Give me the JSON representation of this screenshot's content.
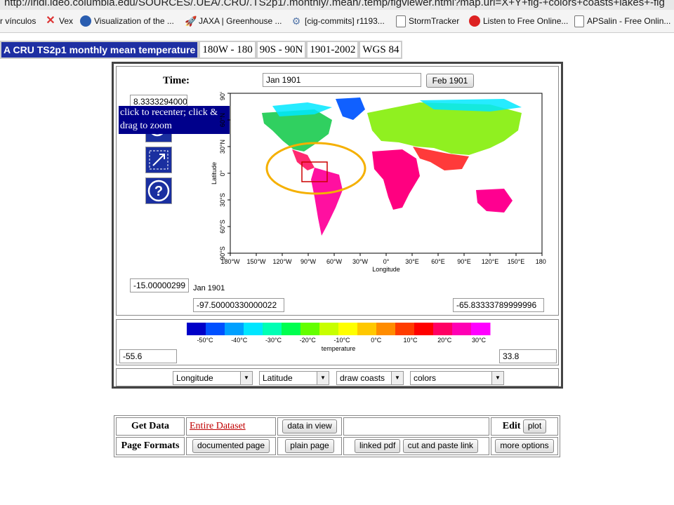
{
  "browser": {
    "url": "http://iridl.ldeo.columbia.edu/SOURCES/.UEA/.CRU/.TS2p1/.monthly/.mean/.temp/figviewer.html?map.url=X+Y+fig-+colors+coasts+lakes+-fig",
    "bookmarks": [
      {
        "label": "r vínculos",
        "icon": "none"
      },
      {
        "label": "Vex",
        "icon": "x-red-icon"
      },
      {
        "label": "Visualization of the ...",
        "icon": "globe-icon"
      },
      {
        "label": "JAXA | Greenhouse ...",
        "icon": "rocket-icon"
      },
      {
        "label": "[cig-commits] r1193...",
        "icon": "gear-icon"
      },
      {
        "label": "StormTracker",
        "icon": "page-icon"
      },
      {
        "label": "Listen to Free Online...",
        "icon": "radio-icon"
      },
      {
        "label": "APSalin - Free Onlin...",
        "icon": "page-icon"
      }
    ]
  },
  "breadcrumbs": [
    "A CRU TS2p1 monthly mean temperature",
    "180W - 180",
    "90S - 90N",
    "1901-2002",
    "WGS 84"
  ],
  "viewer": {
    "time_label": "Time:",
    "time_value": "Jan 1901",
    "next_time_button": "Feb 1901",
    "lat_top_value": "8.3333294000",
    "lat_bottom_value": "-15.00000299",
    "lon_left_value": "-97.50000330000022",
    "lon_right_value": "-65.83333789999996",
    "map_date_caption": "Jan 1901",
    "tooltip": "click to recenter; click & drag to zoom",
    "tools": [
      "zoom-in-icon",
      "expand-icon",
      "help-icon"
    ],
    "map": {
      "xlabel": "Longitude",
      "ylabel": "Latitude",
      "x_ticks": [
        "180°W",
        "150°W",
        "120°W",
        "90°W",
        "60°W",
        "30°W",
        "0°",
        "30°E",
        "60°E",
        "90°E",
        "120°E",
        "150°E",
        "180°"
      ],
      "y_ticks": [
        "90°S",
        "60°S",
        "30°S",
        "0°",
        "30°N",
        "60°N",
        "90°N"
      ]
    },
    "colorbar": {
      "ticks": [
        "-50°C",
        "-40°C",
        "-30°C",
        "-20°C",
        "-10°C",
        "0°C",
        "10°C",
        "20°C",
        "30°C"
      ],
      "label": "temperature",
      "min_value": "-55.6",
      "max_value": "33.8",
      "colors": [
        "#0000c8",
        "#0050ff",
        "#00a0ff",
        "#00e6ff",
        "#00ffb4",
        "#00ff50",
        "#64ff00",
        "#c8ff00",
        "#ffff00",
        "#ffc800",
        "#ff8c00",
        "#ff3c00",
        "#ff0000",
        "#ff0064",
        "#ff00b4",
        "#ff00ff"
      ]
    },
    "controls": [
      {
        "value": "Longitude"
      },
      {
        "value": "Latitude"
      },
      {
        "value": "draw coasts"
      },
      {
        "value": "colors"
      }
    ]
  },
  "bottom": {
    "get_data_label": "Get Data",
    "entire_dataset_link": "Entire Dataset",
    "data_in_view_button": "data in view",
    "edit_label": "Edit",
    "plot_button": "plot",
    "page_formats_label": "Page Formats",
    "formats": [
      "documented page",
      "plain page",
      "linked pdf",
      "cut and paste link",
      "more options"
    ]
  },
  "colors": {
    "crumb_main_bg": "#1e2fa3",
    "tooltip_bg": "#00008b",
    "link": "#c00000",
    "highlight_ellipse": "#f5b000",
    "selection_box": "#cc0000"
  }
}
